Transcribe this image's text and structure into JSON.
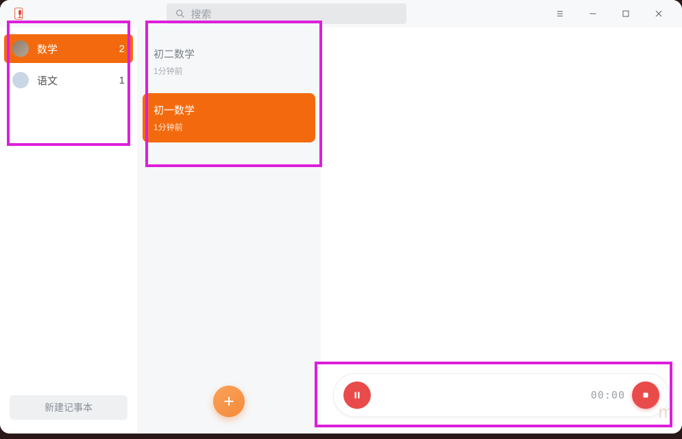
{
  "titlebar": {
    "search_placeholder": "搜索"
  },
  "sidebar": {
    "items": [
      {
        "label": "数学",
        "count": "2",
        "avatar": "cat",
        "active": true
      },
      {
        "label": "语文",
        "count": "1",
        "avatar": "globe",
        "active": false
      }
    ],
    "new_notebook_label": "新建记事本"
  },
  "notes": {
    "items": [
      {
        "title": "初二数学",
        "time": "1分钟前",
        "active": false
      },
      {
        "title": "初一数学",
        "time": "1分钟前",
        "active": true
      }
    ]
  },
  "recorder": {
    "time": "00:00"
  },
  "watermark": "m"
}
